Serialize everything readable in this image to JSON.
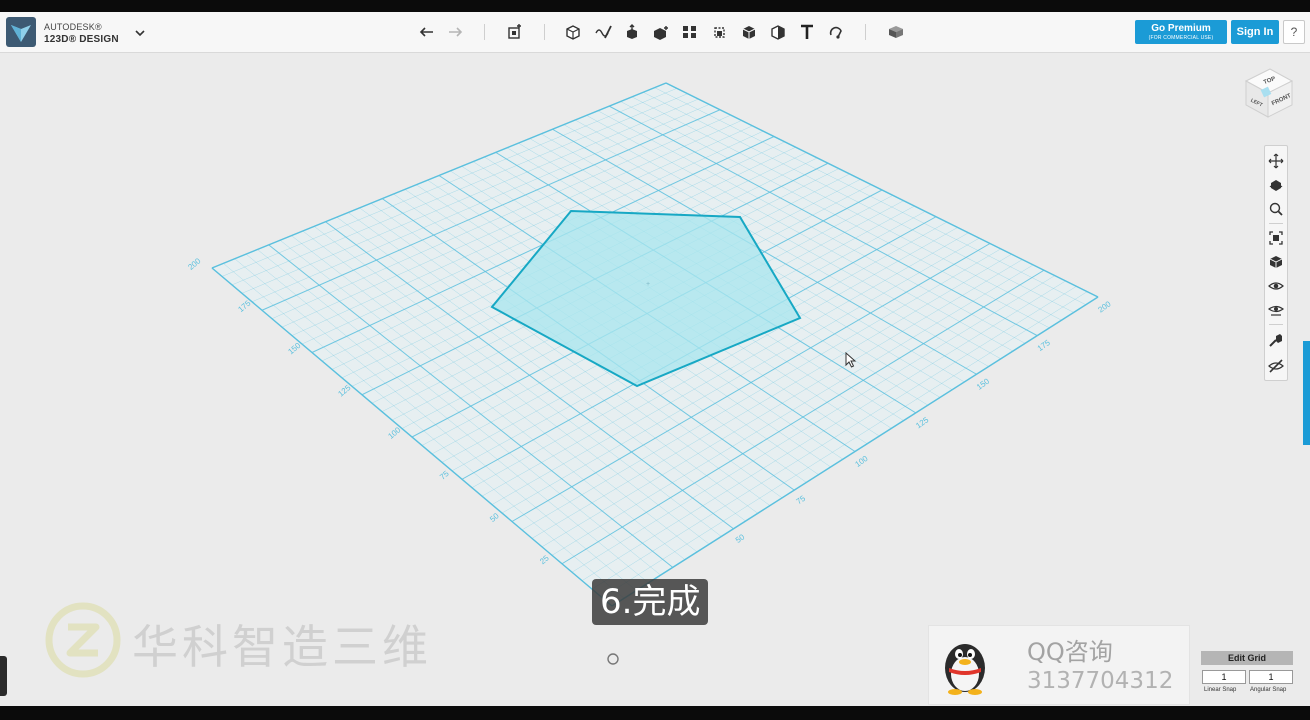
{
  "app": {
    "brand_line1": "AUTODESK®",
    "brand_line2": "123D® DESIGN"
  },
  "toolbar": {
    "icons": [
      "undo-icon",
      "redo-icon",
      "transform-icon",
      "primitives-icon",
      "sketch-icon",
      "construct-icon",
      "modify-icon",
      "pattern-icon",
      "grouping-icon",
      "combine-icon",
      "measure-icon",
      "text-icon",
      "snap-icon",
      "material-icon"
    ],
    "premium_label": "Go Premium",
    "premium_sublabel": "(FOR COMMERCIAL USE)",
    "signin_label": "Sign In",
    "help_label": "?"
  },
  "viewcube": {
    "top": "TOP",
    "left": "LEFT",
    "front": "FRONT"
  },
  "navbar": {
    "icons": [
      "pan-icon",
      "orbit-icon",
      "zoom-icon",
      "fit-icon",
      "view-cube-shade-icon",
      "visibility-icon",
      "show-hide-icon",
      "material-brush-icon",
      "hide-sketch-icon"
    ]
  },
  "grid": {
    "left_axis_labels": [
      "25",
      "50",
      "75",
      "100",
      "125",
      "150",
      "175",
      "200"
    ],
    "right_axis_labels": [
      "50",
      "75",
      "100",
      "125",
      "150",
      "175",
      "200"
    ],
    "line_color": "#5bc0de",
    "sketch_fill": "#a8e6ee",
    "sketch_stroke": "#17a8c4"
  },
  "subtitle": "6.完成",
  "watermark": {
    "text": "华科智造三维"
  },
  "qq_card": {
    "title": "QQ咨询",
    "number": "3137704312"
  },
  "edit_grid": {
    "button_label": "Edit Grid",
    "linear_snap_value": "1",
    "angular_snap_value": "1",
    "linear_snap_label": "Linear Snap",
    "angular_snap_label": "Angular Snap"
  }
}
